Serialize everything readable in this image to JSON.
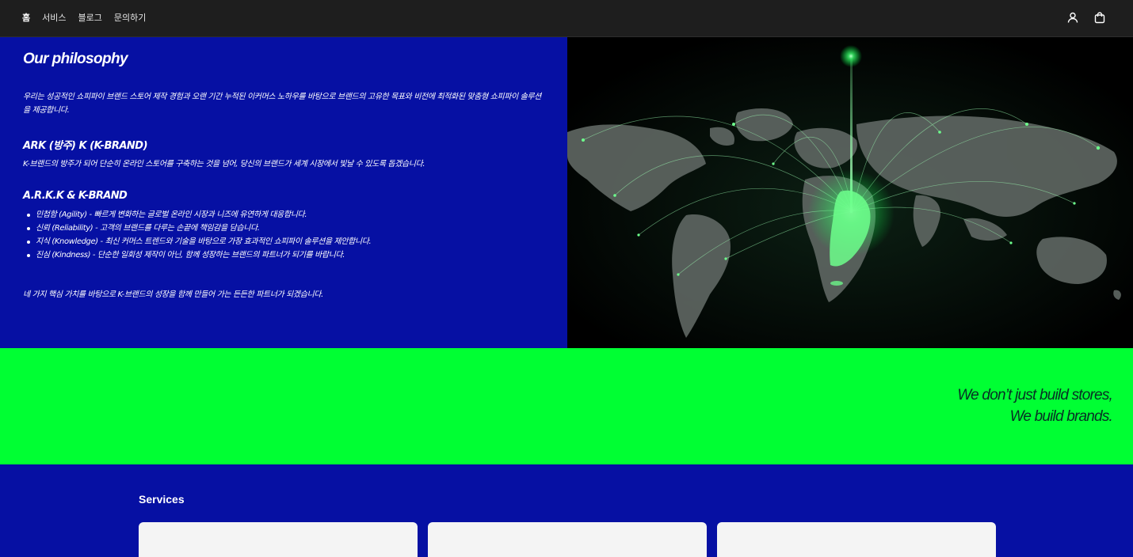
{
  "header": {
    "nav": [
      {
        "label": "홈"
      },
      {
        "label": "서비스"
      },
      {
        "label": "블로그"
      },
      {
        "label": "문의하기"
      }
    ],
    "icons": [
      "account-icon",
      "cart-icon"
    ]
  },
  "philosophy": {
    "title": "Our philosophy",
    "intro": "우리는 성공적인 쇼피파이 브랜드 스토어 제작 경험과 오랜 기간 누적된 이커머스 노하우를 바탕으로 브랜드의 고유한 목표와 비전에 최적화된 맞춤형 쇼피파이 솔루션을 제공합니다.",
    "ark_heading_bold_1": "ARK",
    "ark_heading_paren": "(방주)",
    "ark_heading_bold_2": "K",
    "ark_heading_tail": "(K-BRAND)",
    "ark_text": "K-브랜드의 방주가 되어 단순히 온라인 스토어를 구축하는 것을 넘어, 당신의 브랜드가 세계 시장에서 빛날 수 있도록 돕겠습니다.",
    "values_heading": "A.R.K.K & K-BRAND",
    "values": [
      "민첩함 (Agility) - 빠르게 변화하는 글로벌 온라인 시장과 니즈에 유연하게 대응합니다.",
      "신뢰 (Reliability) - 고객의 브랜드를 다루는 손끝에 책임감을 담습니다.",
      "지식 (Knowledge) - 최신 커머스 트렌드와 기술을 바탕으로 가장 효과적인 쇼피파이 솔루션을 제안합니다.",
      "진심 (Kindness) - 단순한 일회성 제작이 아닌, 함께 성장하는 브랜드의 파트너가 되기를 바랍니다."
    ],
    "closing": "네 가지 핵심 가치를 바탕으로 K-브랜드의 성장을 함께 만들어 가는 든든한 파트너가 되겠습니다."
  },
  "banner": {
    "line1": "We don’t just build stores,",
    "line2": "We build brands."
  },
  "services": {
    "title": "Services"
  },
  "colors": {
    "header_bg": "#1e1e1e",
    "brand_blue": "#0610a3",
    "brand_green": "#00ff33",
    "banner_text": "#073025"
  }
}
